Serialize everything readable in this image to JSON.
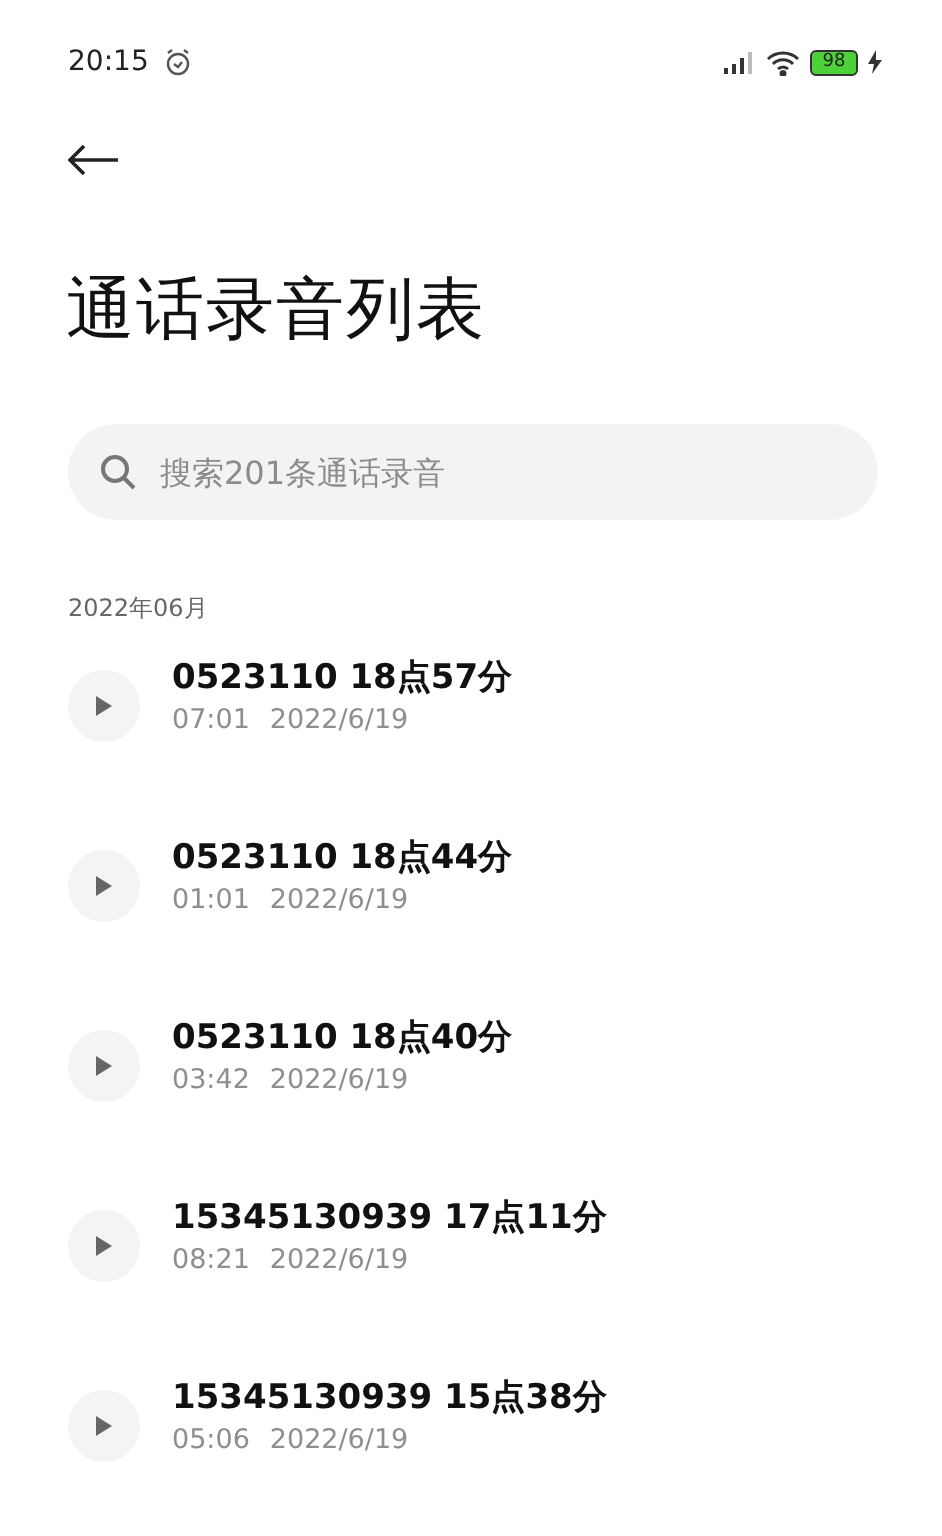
{
  "status_bar": {
    "time": "20:15",
    "battery": "98"
  },
  "title": "通话录音列表",
  "search": {
    "placeholder": "搜索201条通话录音"
  },
  "section": "2022年06月",
  "recordings": [
    {
      "name": "0523110 18点57分",
      "duration": "07:01",
      "date": "2022/6/19"
    },
    {
      "name": "0523110 18点44分",
      "duration": "01:01",
      "date": "2022/6/19"
    },
    {
      "name": "0523110 18点40分",
      "duration": "03:42",
      "date": "2022/6/19"
    },
    {
      "name": "15345130939 17点11分",
      "duration": "08:21",
      "date": "2022/6/19"
    },
    {
      "name": "15345130939 15点38分",
      "duration": "05:06",
      "date": "2022/6/19"
    }
  ]
}
